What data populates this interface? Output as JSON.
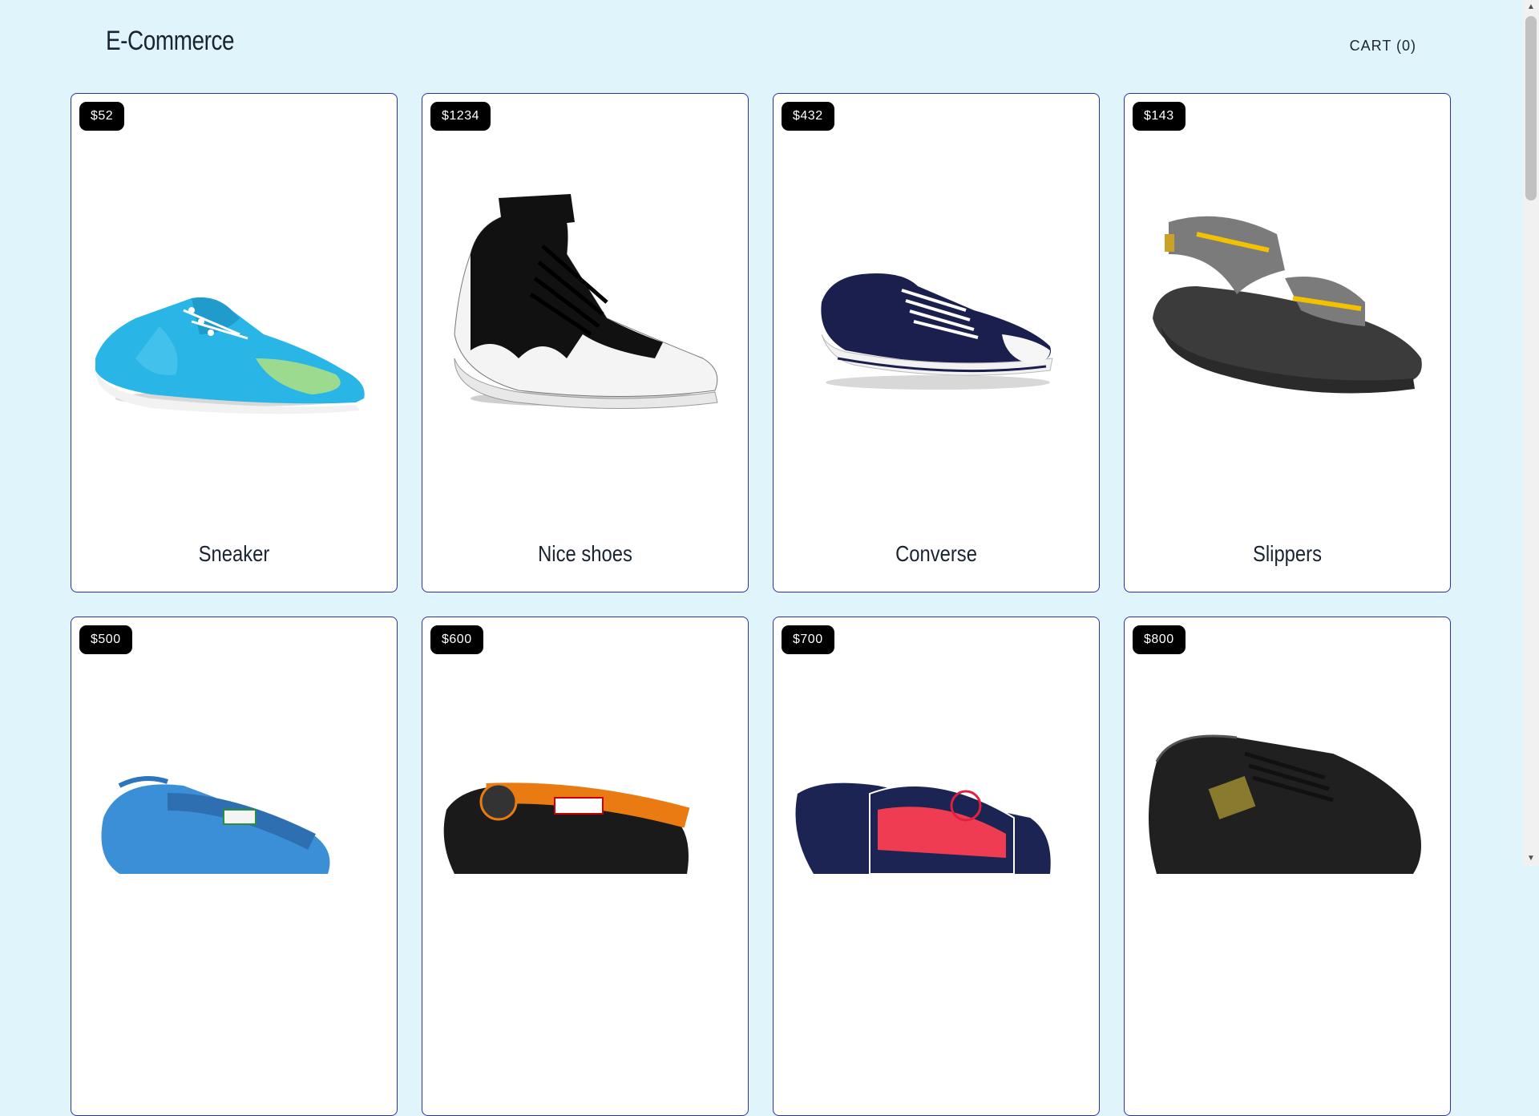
{
  "header": {
    "logo": "E-Commerce",
    "cart_label": "CART (0)"
  },
  "products": [
    {
      "price": "$52",
      "name": "Sneaker",
      "icon": "blue-sneaker"
    },
    {
      "price": "$1234",
      "name": "Nice shoes",
      "icon": "high-top-sneaker"
    },
    {
      "price": "$432",
      "name": "Converse",
      "icon": "navy-converse"
    },
    {
      "price": "$143",
      "name": "Slippers",
      "icon": "grey-sandal"
    },
    {
      "price": "$500",
      "name": "",
      "icon": "blue-flip-flop"
    },
    {
      "price": "$600",
      "name": "",
      "icon": "orange-flip-flop"
    },
    {
      "price": "$700",
      "name": "",
      "icon": "red-navy-slide"
    },
    {
      "price": "$800",
      "name": "",
      "icon": "black-sport-shoe"
    }
  ],
  "colors": {
    "background": "#dff4fb",
    "card_border": "#2b2fa8",
    "badge": "#000000"
  }
}
